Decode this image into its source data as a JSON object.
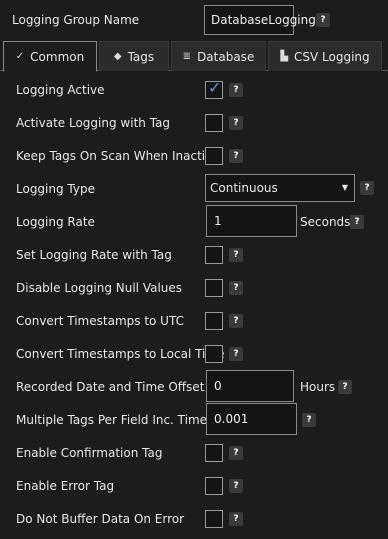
{
  "header": {
    "group_name_label": "Logging Group Name",
    "group_name_value": "DatabaseLogging"
  },
  "help_glyph": "?",
  "tabs": [
    {
      "label": "Common",
      "icon": "check-icon",
      "glyph": "✓"
    },
    {
      "label": "Tags",
      "icon": "tag-icon",
      "glyph": "◆"
    },
    {
      "label": "Database",
      "icon": "database-icon",
      "glyph": "≣"
    },
    {
      "label": "CSV Logging",
      "icon": "csv-icon",
      "glyph": "▙"
    }
  ],
  "rows": {
    "logging_active": {
      "label": "Logging Active",
      "checked": true
    },
    "activate_with_tag": {
      "label": "Activate Logging with Tag",
      "checked": false
    },
    "keep_tags_on_scan": {
      "label": "Keep Tags On Scan When Inactive",
      "checked": false
    },
    "logging_type": {
      "label": "Logging Type",
      "value": "Continuous"
    },
    "logging_rate": {
      "label": "Logging Rate",
      "value": "1",
      "unit": "Seconds"
    },
    "set_rate_with_tag": {
      "label": "Set Logging Rate with Tag",
      "checked": false
    },
    "disable_null": {
      "label": "Disable Logging Null Values",
      "checked": false
    },
    "convert_utc": {
      "label": "Convert Timestamps to UTC",
      "checked": false
    },
    "convert_local": {
      "label": "Convert Timestamps to Local Time",
      "checked": false
    },
    "recorded_offset": {
      "label": "Recorded Date and Time Offset",
      "value": "0",
      "unit": "Hours"
    },
    "multiple_tags": {
      "label": "Multiple Tags Per Field Inc. Time",
      "value": "0.001"
    },
    "enable_confirmation": {
      "label": "Enable Confirmation Tag",
      "checked": false
    },
    "enable_error": {
      "label": "Enable Error Tag",
      "checked": false
    },
    "no_buffer": {
      "label": "Do Not Buffer Data On Error",
      "checked": false
    }
  },
  "colors": {
    "background": "#1c1c1c",
    "check": "#4a9be8",
    "help_bg": "#3a3a3a"
  }
}
